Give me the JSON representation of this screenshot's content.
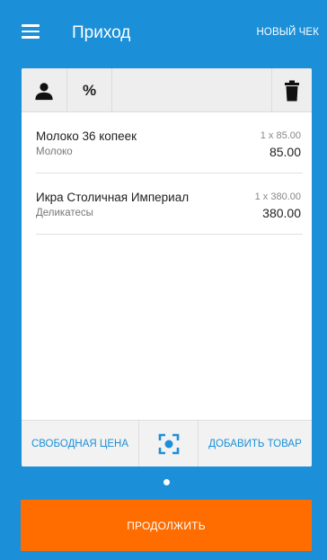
{
  "appbar": {
    "menu_icon": "menu-icon",
    "title": "Приход",
    "new_check_label": "НОВЫЙ ЧЕК"
  },
  "toolbar": {
    "user_icon": "person-icon",
    "percent_label": "%",
    "delete_icon": "trash-icon"
  },
  "items": [
    {
      "name": "Молоко 36 копеек",
      "category": "Молоко",
      "qty_price": "1 x 85.00",
      "sum": "85.00"
    },
    {
      "name": "Икра Столичная Империал",
      "category": "Деликатесы",
      "qty_price": "1 x 380.00",
      "sum": "380.00"
    }
  ],
  "bottombar": {
    "free_price_label": "СВОБОДНАЯ ЦЕНА",
    "scan_icon": "barcode-scan-icon",
    "add_item_label": "ДОБАВИТЬ ТОВАР"
  },
  "continue_label": "ПРОДОЛЖИТЬ",
  "colors": {
    "background": "#1b8fd8",
    "accent": "#1b8fd8",
    "continue_button": "#ff6d00"
  }
}
